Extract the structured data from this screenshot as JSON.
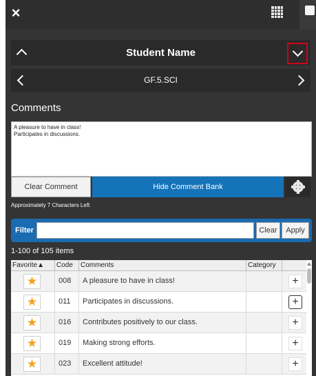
{
  "top_bar": {
    "close_label": "×",
    "grid_icon": "grid-icon",
    "chat_icon": "comment-icon"
  },
  "student": {
    "name": "Student Name",
    "up_icon": "chevron-up-icon",
    "down_icon": "chevron-down-icon"
  },
  "course": {
    "name": "GF.5.SCI",
    "prev_icon": "chevron-left-icon",
    "next_icon": "chevron-right-icon"
  },
  "comments": {
    "heading": "Comments",
    "text": "A pleasure to have in class!\nParticipates in discussions.",
    "clear_label": "Clear Comment",
    "hide_bank_label": "Hide Comment Bank",
    "settings_icon": "gear-icon",
    "chars_left": "Approximately 7 Characters Left"
  },
  "filter": {
    "label": "Filter",
    "value": "",
    "clear_label": "Clear",
    "apply_label": "Apply"
  },
  "bank": {
    "count_text": "1-100 of 105 items",
    "columns": {
      "favorite": "Favorite▲",
      "code": "Code",
      "comments": "Comments",
      "category": "Category"
    },
    "rows": [
      {
        "code": "008",
        "comment": "A pleasure to have in class!",
        "category": "",
        "add": "+"
      },
      {
        "code": "011",
        "comment": "Participates in discussions.",
        "category": "",
        "add": "+"
      },
      {
        "code": "016",
        "comment": "Contributes positively to our class.",
        "category": "",
        "add": "+"
      },
      {
        "code": "019",
        "comment": "Making strong efforts.",
        "category": "",
        "add": "+"
      },
      {
        "code": "023",
        "comment": "Excellent attitude!",
        "category": "",
        "add": "+"
      }
    ],
    "star_glyph": "★"
  },
  "colors": {
    "panel": "#343434",
    "accent_blue": "#1473b9",
    "star": "#f2a21b",
    "highlight_red": "#d0021b"
  }
}
